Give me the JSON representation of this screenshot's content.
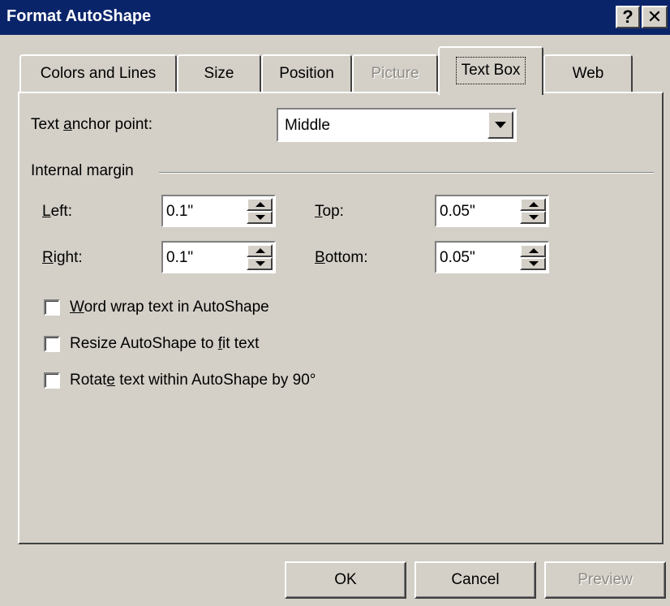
{
  "window": {
    "title": "Format AutoShape",
    "help_glyph": "?",
    "close_glyph": "✕"
  },
  "tabs": [
    {
      "label": "Colors and Lines",
      "state": "normal"
    },
    {
      "label": "Size",
      "state": "normal"
    },
    {
      "label": "Position",
      "state": "normal"
    },
    {
      "label": "Picture",
      "state": "disabled"
    },
    {
      "label": "Text Box",
      "state": "active"
    },
    {
      "label": "Web",
      "state": "normal"
    }
  ],
  "anchor": {
    "label_pre": "Text ",
    "label_key": "a",
    "label_post": "nchor point:",
    "value": "Middle"
  },
  "internal_margin": {
    "heading": "Internal margin",
    "left": {
      "label_key": "L",
      "label_post": "eft:",
      "value": "0.1\""
    },
    "right": {
      "label_key": "R",
      "label_post": "ight:",
      "value": "0.1\""
    },
    "top": {
      "label_key": "T",
      "label_post": "op:",
      "value": "0.05\""
    },
    "bottom": {
      "label_key": "B",
      "label_post": "ottom:",
      "value": "0.05\""
    }
  },
  "options": {
    "word_wrap": {
      "pre": "",
      "key": "W",
      "post": "ord wrap text in AutoShape",
      "checked": false
    },
    "resize": {
      "pre": "Resize AutoShape to ",
      "key": "f",
      "post": "it text",
      "checked": false
    },
    "rotate": {
      "pre": "Rotat",
      "key": "e",
      "post": " text within AutoShape by 90°",
      "checked": false
    }
  },
  "buttons": {
    "ok": "OK",
    "cancel": "Cancel",
    "preview": "Preview"
  },
  "colors": {
    "titlebar": "#0a246a",
    "face": "#d4d0c8",
    "disabled_text": "#8f8c86"
  }
}
